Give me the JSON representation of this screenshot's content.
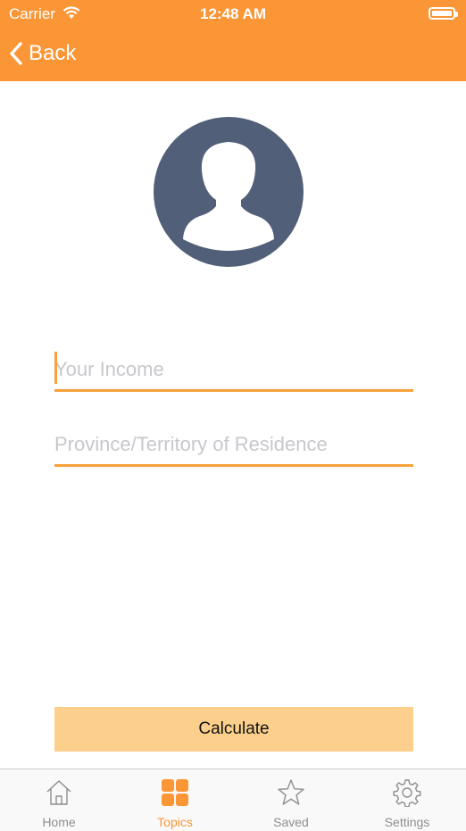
{
  "status_bar": {
    "carrier": "Carrier",
    "time": "12:48 AM"
  },
  "nav": {
    "back_label": "Back"
  },
  "form": {
    "income_placeholder": "Your Income",
    "province_placeholder": "Province/Territory of Residence",
    "calculate_label": "Calculate"
  },
  "tabbar": {
    "items": [
      {
        "label": "Home",
        "icon": "home-icon"
      },
      {
        "label": "Topics",
        "icon": "grid-icon"
      },
      {
        "label": "Saved",
        "icon": "star-icon"
      },
      {
        "label": "Settings",
        "icon": "gear-icon"
      }
    ],
    "active": "Topics"
  },
  "colors": {
    "accent": "#fb9637",
    "avatar": "#525f78",
    "button": "#fcd08c"
  }
}
